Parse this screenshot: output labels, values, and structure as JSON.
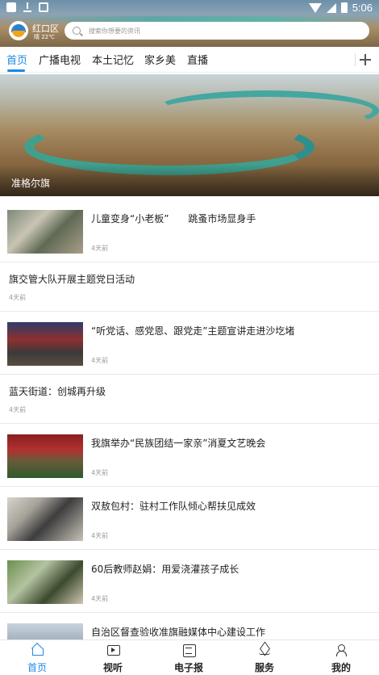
{
  "status_bar": {
    "time": "5:06"
  },
  "header": {
    "location": "红口区",
    "weather": "晴 22℃",
    "search_placeholder": "搜索你想要的资讯"
  },
  "tabs": [
    {
      "label": "首页",
      "active": true
    },
    {
      "label": "广播电视",
      "active": false
    },
    {
      "label": "本土记忆",
      "active": false
    },
    {
      "label": "家乡美",
      "active": false
    },
    {
      "label": "直播",
      "active": false
    }
  ],
  "banner": {
    "caption": "准格尔旗"
  },
  "news": [
    {
      "title": "儿童变身“小老板”　　跳蚤市场显身手",
      "time": "4天前",
      "has_image": true
    },
    {
      "title": "旗交管大队开展主题党日活动",
      "time": "4天前",
      "has_image": false
    },
    {
      "title": "“听党话、感党恩、跟党走”主题宣讲走进沙圪堵",
      "time": "4天前",
      "has_image": true
    },
    {
      "title": "蓝天街道：创城再升级",
      "time": "4天前",
      "has_image": false
    },
    {
      "title": "我旗举办“民族团结一家亲”消夏文艺晚会",
      "time": "4天前",
      "has_image": true
    },
    {
      "title": "双敖包村：驻村工作队倾心帮扶见成效",
      "time": "4天前",
      "has_image": true
    },
    {
      "title": "60后教师赵娟：用爱浇灌孩子成长",
      "time": "4天前",
      "has_image": true
    },
    {
      "title": "自治区督查验收准旗融媒体中心建设工作",
      "time": "",
      "has_image": true
    }
  ],
  "bottom_nav": [
    {
      "label": "首页",
      "icon": "home-icon",
      "active": true
    },
    {
      "label": "视听",
      "icon": "video-icon",
      "active": false
    },
    {
      "label": "电子报",
      "icon": "newspaper-icon",
      "active": false
    },
    {
      "label": "服务",
      "icon": "layers-icon",
      "active": false
    },
    {
      "label": "我的",
      "icon": "user-icon",
      "active": false
    }
  ],
  "colors": {
    "accent": "#1e88e5",
    "text": "#222222",
    "muted": "#999999"
  }
}
